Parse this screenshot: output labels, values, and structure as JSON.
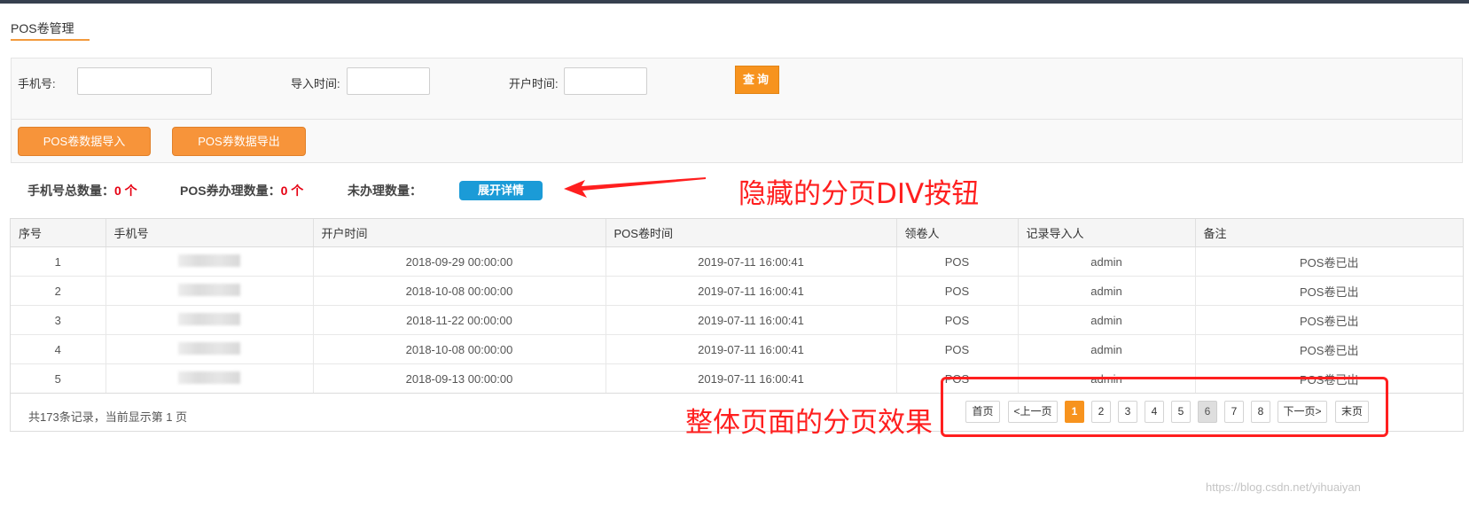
{
  "page": {
    "title": "POS卷管理"
  },
  "filters": {
    "phone_label": "手机号:",
    "phone_value": "",
    "import_time_label": "导入时间:",
    "import_time_value": "",
    "open_time_label": "开户时间:",
    "open_time_value": "",
    "search_label": "查询"
  },
  "actions": {
    "import_label": "POS卷数据导入",
    "export_label": "POS券数据导出"
  },
  "stats": {
    "total_label": "手机号总数量：",
    "total_value": "0 个",
    "handled_label": "POS券办理数量：",
    "handled_value": "0 个",
    "unhandled_label": "未办理数量：",
    "expand_label": "展开详情"
  },
  "annotations": {
    "hidden_pager_note": "隐藏的分页DIV按钮",
    "page_pager_note": "整体页面的分页效果",
    "color": "#ff1f1f"
  },
  "table": {
    "columns": [
      "序号",
      "手机号",
      "开户时间",
      "POS卷时间",
      "领卷人",
      "记录导入人",
      "备注"
    ],
    "rows": [
      {
        "no": "1",
        "phone": "",
        "open_time": "2018-09-29 00:00:00",
        "pos_time": "2019-07-11 16:00:41",
        "receiver": "POS",
        "importer": "admin",
        "remark": "POS卷已出"
      },
      {
        "no": "2",
        "phone": "",
        "open_time": "2018-10-08 00:00:00",
        "pos_time": "2019-07-11 16:00:41",
        "receiver": "POS",
        "importer": "admin",
        "remark": "POS卷已出"
      },
      {
        "no": "3",
        "phone": "",
        "open_time": "2018-11-22 00:00:00",
        "pos_time": "2019-07-11 16:00:41",
        "receiver": "POS",
        "importer": "admin",
        "remark": "POS卷已出"
      },
      {
        "no": "4",
        "phone": "",
        "open_time": "2018-10-08 00:00:00",
        "pos_time": "2019-07-11 16:00:41",
        "receiver": "POS",
        "importer": "admin",
        "remark": "POS卷已出"
      },
      {
        "no": "5",
        "phone": "",
        "open_time": "2018-09-13 00:00:00",
        "pos_time": "2019-07-11 16:00:41",
        "receiver": "POS",
        "importer": "admin",
        "remark": "POS卷已出"
      }
    ]
  },
  "footer": {
    "summary": "共173条记录，当前显示第 1 页"
  },
  "pager": {
    "first": "首页",
    "prev": "<上一页",
    "pages": [
      "1",
      "2",
      "3",
      "4",
      "5",
      "6",
      "7",
      "8"
    ],
    "current": "1",
    "next": "下一页>",
    "last": "末页"
  },
  "watermark": "https://blog.csdn.net/yihuaiyan",
  "colors": {
    "accent": "#f7931e",
    "expand_button": "#1b9bd7",
    "count_red": "#e60012"
  }
}
